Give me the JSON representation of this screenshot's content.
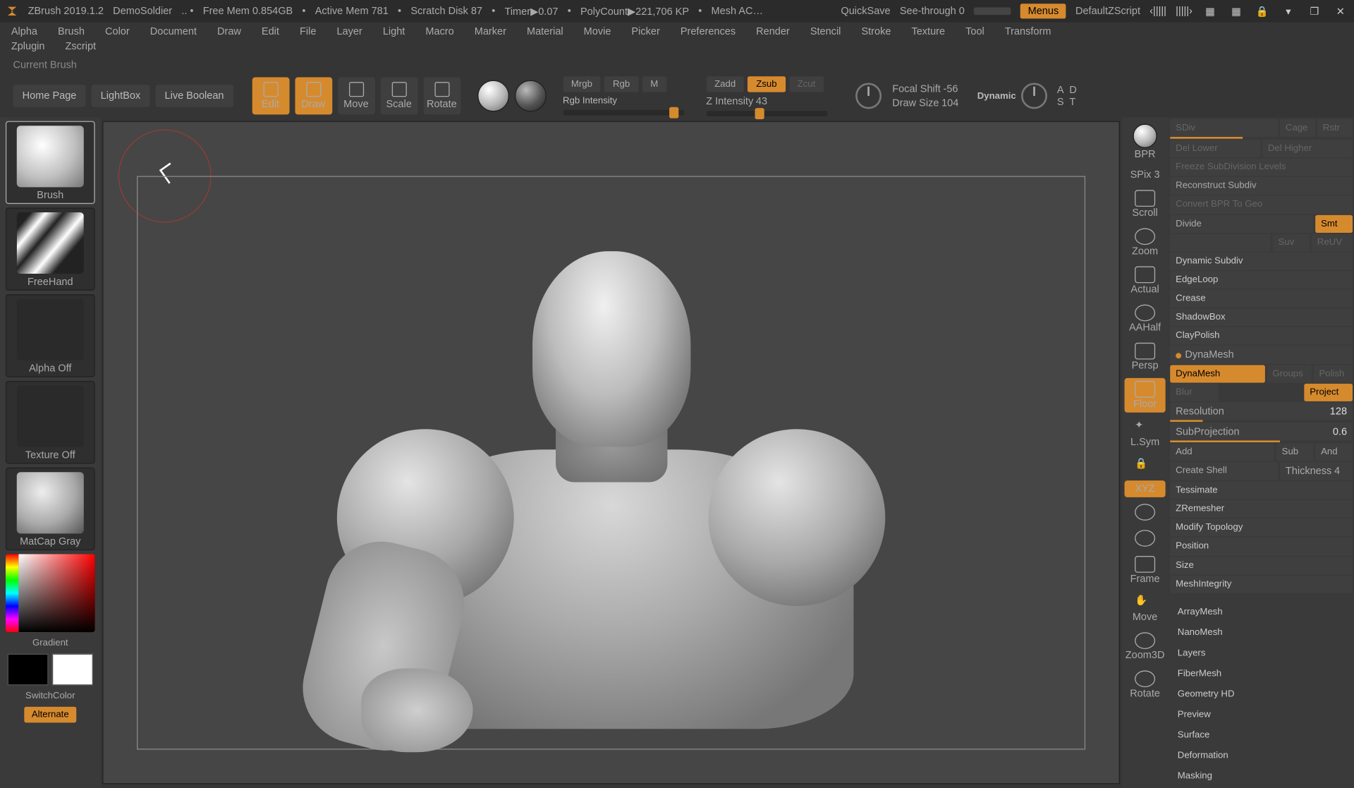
{
  "top": {
    "app": "ZBrush 2019.1.2",
    "project": "DemoSoldier",
    "freemem": "Free Mem 0.854GB",
    "activemem": "Active Mem 781",
    "scratch": "Scratch Disk 87",
    "timer": "Timer▶0.07",
    "polys": "PolyCount▶221,706 KP",
    "mesh": "Mesh AC…",
    "quicksave": "QuickSave",
    "seethrough": "See-through  0",
    "menus": "Menus",
    "zscript": "DefaultZScript"
  },
  "menu": [
    "Alpha",
    "Brush",
    "Color",
    "Document",
    "Draw",
    "Edit",
    "File",
    "Layer",
    "Light",
    "Macro",
    "Marker",
    "Material",
    "Movie",
    "Picker",
    "Preferences",
    "Render",
    "Stencil",
    "Stroke",
    "Texture",
    "Tool",
    "Transform",
    "Zplugin",
    "Zscript"
  ],
  "status": "Current Brush",
  "toolbar": {
    "home": "Home Page",
    "lightbox": "LightBox",
    "liveboolean": "Live Boolean",
    "modes": [
      {
        "id": "edit",
        "label": "Edit",
        "active": true
      },
      {
        "id": "draw",
        "label": "Draw",
        "active": true
      },
      {
        "id": "move",
        "label": "Move",
        "active": false
      },
      {
        "id": "scale",
        "label": "Scale",
        "active": false
      },
      {
        "id": "rotate",
        "label": "Rotate",
        "active": false
      }
    ],
    "mrgb": "Mrgb",
    "rgb": "Rgb",
    "m": "M",
    "rgbint": "Rgb Intensity",
    "zadd": "Zadd",
    "zsub": "Zsub",
    "zcut": "Zcut",
    "zint_label": "Z Intensity",
    "zint_val": "43",
    "focal_label": "Focal Shift",
    "focal_val": "-56",
    "draw_label": "Draw Size",
    "draw_val": "104",
    "dynamic": "Dynamic",
    "a": "A",
    "s": "S",
    "d": "D",
    "t": "T"
  },
  "left": {
    "brush": "Brush",
    "stroke": "FreeHand",
    "alpha": "Alpha Off",
    "texture": "Texture Off",
    "matcap": "MatCap Gray",
    "gradient": "Gradient",
    "switch": "SwitchColor",
    "alternate": "Alternate"
  },
  "nav": [
    {
      "id": "bpr",
      "label": "BPR"
    },
    {
      "id": "spix",
      "label": "SPix 3"
    },
    {
      "id": "scroll",
      "label": "Scroll"
    },
    {
      "id": "zoom",
      "label": "Zoom"
    },
    {
      "id": "actual",
      "label": "Actual"
    },
    {
      "id": "aahalf",
      "label": "AAHalf"
    },
    {
      "id": "persp",
      "label": "Persp"
    },
    {
      "id": "floor",
      "label": "Floor",
      "active": true
    },
    {
      "id": "lsym",
      "label": "L.Sym"
    },
    {
      "id": "lock",
      "label": ""
    },
    {
      "id": "xyz",
      "label": "XYZ",
      "active": true
    },
    {
      "id": "rot1",
      "label": ""
    },
    {
      "id": "rot2",
      "label": ""
    },
    {
      "id": "frame",
      "label": "Frame"
    },
    {
      "id": "movevp",
      "label": "Move"
    },
    {
      "id": "zoom3d",
      "label": "Zoom3D"
    },
    {
      "id": "rotate",
      "label": "Rotate"
    }
  ],
  "panel": {
    "sdiv": "SDiv",
    "cage": "Cage",
    "rstr": "Rstr",
    "dellower": "Del Lower",
    "delhigher": "Del Higher",
    "freeze": "Freeze SubDivision Levels",
    "reconstruct": "Reconstruct Subdiv",
    "convert": "Convert BPR To Geo",
    "divide": "Divide",
    "smt": "Smt",
    "suv": "Suv",
    "reuv": "ReUV",
    "dynsub": "Dynamic Subdiv",
    "edgeloop": "EdgeLoop",
    "crease": "Crease",
    "shadowbox": "ShadowBox",
    "claypolish": "ClayPolish",
    "dynamesh_section": "DynaMesh",
    "dynamesh": "DynaMesh",
    "groups": "Groups",
    "polish": "Polish",
    "blur": "Blur",
    "project": "Project",
    "resolution_l": "Resolution",
    "resolution_v": "128",
    "subproj_l": "SubProjection",
    "subproj_v": "0.6",
    "add": "Add",
    "sub": "Sub",
    "and": "And",
    "createshell": "Create Shell",
    "thickness_l": "Thickness",
    "thickness_v": "4",
    "tessimate": "Tessimate",
    "zremesher": "ZRemesher",
    "modtopo": "Modify Topology",
    "position": "Position",
    "size": "Size",
    "meshint": "MeshIntegrity",
    "arraymesh": "ArrayMesh",
    "nanomesh": "NanoMesh",
    "layers": "Layers",
    "fibermesh": "FiberMesh",
    "geomhd": "Geometry HD",
    "preview": "Preview",
    "surface": "Surface",
    "deformation": "Deformation",
    "masking": "Masking"
  }
}
